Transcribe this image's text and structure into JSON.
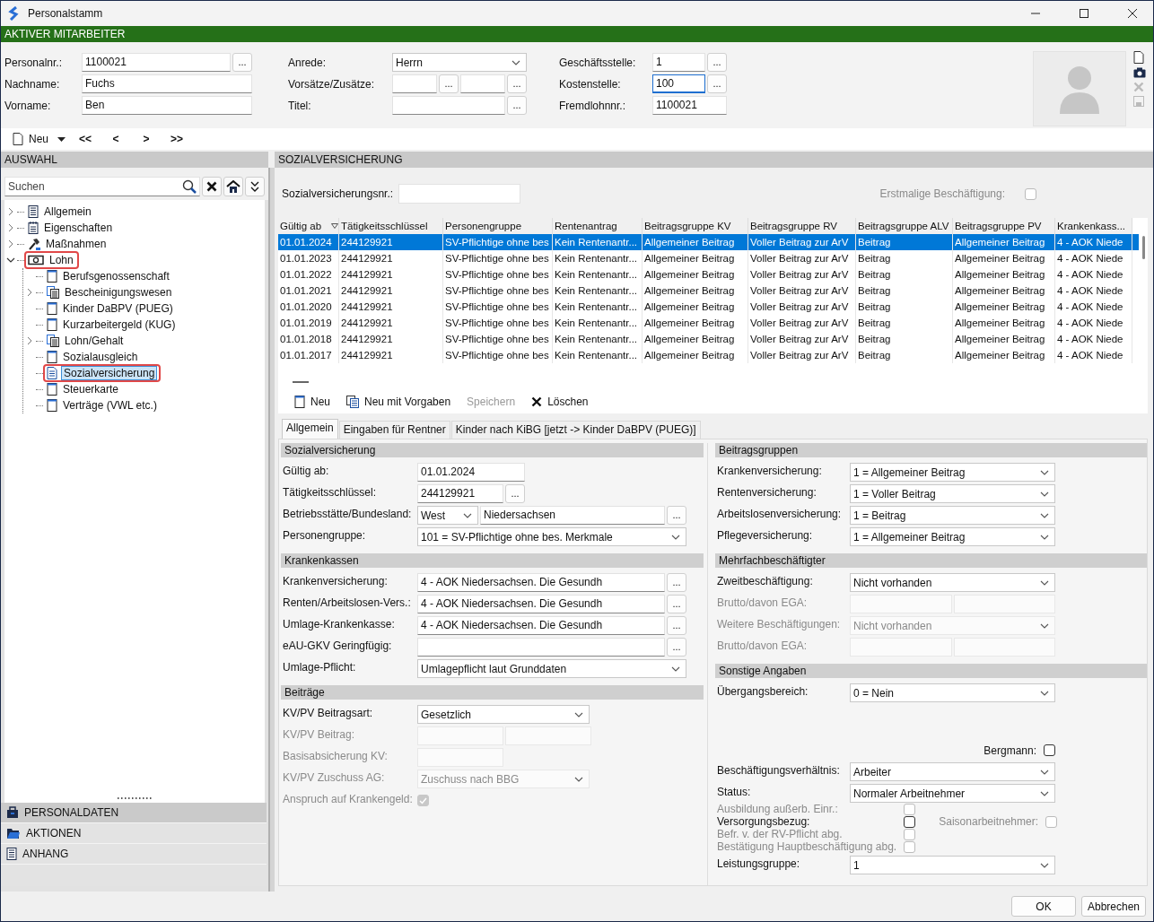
{
  "window": {
    "title": "Personalstamm"
  },
  "banner": "AKTIVER MITARBEITER",
  "header": {
    "columns": [
      [
        {
          "label": "Personalnr.:",
          "parts": [
            {
              "kind": "field",
              "value": "1100021",
              "focused": false
            },
            {
              "kind": "more",
              "text": "..."
            }
          ]
        },
        {
          "label": "Nachname:",
          "parts": [
            {
              "kind": "field",
              "value": "Fuchs",
              "focused": false
            }
          ]
        },
        {
          "label": "Vorname:",
          "parts": [
            {
              "kind": "field",
              "value": "Ben",
              "focused": false
            }
          ]
        }
      ],
      [
        {
          "label": "Anrede:",
          "parts": [
            {
              "kind": "select",
              "value": "Herrn"
            }
          ]
        },
        {
          "label": "Vorsätze/Zusätze:",
          "parts": [
            {
              "kind": "shortfield",
              "focused": false
            },
            {
              "kind": "more",
              "text": "..."
            },
            {
              "kind": "shortfield",
              "focused": false
            },
            {
              "kind": "more",
              "text": "..."
            }
          ]
        },
        {
          "label": "Titel:",
          "parts": [
            {
              "kind": "field",
              "focused": false
            },
            {
              "kind": "more",
              "text": "..."
            }
          ]
        }
      ],
      [
        {
          "label": "Geschäftsstelle:",
          "parts": [
            {
              "kind": "field",
              "value": "1",
              "focused": false
            },
            {
              "kind": "more",
              "text": "..."
            }
          ]
        },
        {
          "label": "Kostenstelle:",
          "parts": [
            {
              "kind": "field",
              "value": "100",
              "focused": true
            },
            {
              "kind": "more",
              "text": "..."
            }
          ]
        },
        {
          "label": "Fremdlohnnr.:",
          "parts": [
            {
              "kind": "field",
              "value": "1100021",
              "focused": false
            }
          ]
        }
      ]
    ]
  },
  "toolbar": {
    "new": "Neu",
    "nav": [
      "<<",
      "<",
      ">",
      ">>"
    ]
  },
  "selection": {
    "title": "AUSWAHL",
    "search": {
      "placeholder": "Suchen"
    },
    "tree": [
      {
        "label": "Allgemein",
        "kind": "list",
        "expandable": true,
        "expanded": false,
        "selected": false,
        "highlighted": false
      },
      {
        "label": "Eigenschaften",
        "kind": "notepad",
        "expandable": true,
        "expanded": false,
        "selected": false,
        "highlighted": false
      },
      {
        "label": "Maßnahmen",
        "kind": "hammer",
        "expandable": true,
        "expanded": false,
        "selected": false,
        "highlighted": false
      },
      {
        "label": "Lohn",
        "kind": "money",
        "expandable": true,
        "expanded": true,
        "selected": false,
        "highlighted": true,
        "children": [
          {
            "label": "Berufsgenossenschaft",
            "kind": "page",
            "expandable": false,
            "selected": false,
            "highlighted": false
          },
          {
            "label": "Bescheinigungswesen",
            "kind": "pages",
            "expandable": true,
            "expanded": false,
            "selected": false,
            "highlighted": false
          },
          {
            "label": "Kinder DaBPV (PUEG)",
            "kind": "page",
            "expandable": false,
            "selected": false,
            "highlighted": false
          },
          {
            "label": "Kurzarbeitergeld (KUG)",
            "kind": "page",
            "expandable": false,
            "selected": false,
            "highlighted": false
          },
          {
            "label": "Lohn/Gehalt",
            "kind": "pages",
            "expandable": true,
            "expanded": false,
            "selected": false,
            "highlighted": false
          },
          {
            "label": "Sozialausgleich",
            "kind": "page",
            "expandable": false,
            "selected": false,
            "highlighted": false
          },
          {
            "label": "Sozialversicherung",
            "kind": "document",
            "expandable": false,
            "selected": true,
            "highlighted": true
          },
          {
            "label": "Steuerkarte",
            "kind": "page",
            "expandable": false,
            "selected": false,
            "highlighted": false
          },
          {
            "label": "Verträge (VWL etc.)",
            "kind": "page",
            "expandable": false,
            "selected": false,
            "highlighted": false
          }
        ]
      }
    ],
    "panels": [
      {
        "label": "PERSONALDATEN",
        "kind": "case",
        "selected": true
      },
      {
        "label": "AKTIONEN",
        "kind": "folder",
        "selected": false
      },
      {
        "label": "ANHANG",
        "kind": "list",
        "selected": false
      }
    ]
  },
  "detail": {
    "title": "SOZIALVERSICHERUNG",
    "sv_number": {
      "label": "Sozialversicherungsnr.:"
    },
    "first_employment": {
      "label": "Erstmalige Beschäftigung:",
      "checked": false
    },
    "table": {
      "columns": [
        {
          "label": "Gültig ab",
          "sorted": true
        },
        {
          "label": "Tätigkeitsschlüssel",
          "sorted": false
        },
        {
          "label": "Personengruppe",
          "sorted": false
        },
        {
          "label": "Rentenantrag",
          "sorted": false
        },
        {
          "label": "Beitragsgruppe KV",
          "sorted": false
        },
        {
          "label": "Beitragsgruppe RV",
          "sorted": false
        },
        {
          "label": "Beitragsgruppe ALV",
          "sorted": false
        },
        {
          "label": "Beitragsgruppe PV",
          "sorted": false
        },
        {
          "label": "Krankenkass...",
          "sorted": false
        }
      ],
      "rows": [
        {
          "selected": true,
          "cells": [
            "01.01.2024",
            "244129921",
            "SV-Pflichtige ohne bes",
            "Kein Rentenantr...",
            "Allgemeiner Beitrag",
            "Voller Beitrag zur ArV",
            "Beitrag",
            "Allgemeiner Beitrag",
            "4 - AOK Niede"
          ]
        },
        {
          "selected": false,
          "cells": [
            "01.01.2023",
            "244129921",
            "SV-Pflichtige ohne bes",
            "Kein Rentenantr...",
            "Allgemeiner Beitrag",
            "Voller Beitrag zur ArV",
            "Beitrag",
            "Allgemeiner Beitrag",
            "4 - AOK Niede"
          ]
        },
        {
          "selected": false,
          "cells": [
            "01.01.2022",
            "244129921",
            "SV-Pflichtige ohne bes",
            "Kein Rentenantr...",
            "Allgemeiner Beitrag",
            "Voller Beitrag zur ArV",
            "Beitrag",
            "Allgemeiner Beitrag",
            "4 - AOK Niede"
          ]
        },
        {
          "selected": false,
          "cells": [
            "01.01.2021",
            "244129921",
            "SV-Pflichtige ohne bes",
            "Kein Rentenantr...",
            "Allgemeiner Beitrag",
            "Voller Beitrag zur ArV",
            "Beitrag",
            "Allgemeiner Beitrag",
            "4 - AOK Niede"
          ]
        },
        {
          "selected": false,
          "cells": [
            "01.01.2020",
            "244129921",
            "SV-Pflichtige ohne bes",
            "Kein Rentenantr...",
            "Allgemeiner Beitrag",
            "Voller Beitrag zur ArV",
            "Beitrag",
            "Allgemeiner Beitrag",
            "4 - AOK Niede"
          ]
        },
        {
          "selected": false,
          "cells": [
            "01.01.2019",
            "244129921",
            "SV-Pflichtige ohne bes",
            "Kein Rentenantr...",
            "Allgemeiner Beitrag",
            "Voller Beitrag zur ArV",
            "Beitrag",
            "Allgemeiner Beitrag",
            "4 - AOK Niede"
          ]
        },
        {
          "selected": false,
          "cells": [
            "01.01.2018",
            "244129921",
            "SV-Pflichtige ohne bes",
            "Kein Rentenantr...",
            "Allgemeiner Beitrag",
            "Voller Beitrag zur ArV",
            "Beitrag",
            "Allgemeiner Beitrag",
            "4 - AOK Niede"
          ]
        },
        {
          "selected": false,
          "cells": [
            "01.01.2017",
            "244129921",
            "SV-Pflichtige ohne bes",
            "Kein Rentenantr...",
            "Allgemeiner Beitrag",
            "Voller Beitrag zur ArV",
            "Beitrag",
            "Allgemeiner Beitrag",
            "4 - AOK Niede"
          ]
        }
      ]
    },
    "actions": [
      {
        "label": "Neu",
        "kind": "page",
        "disabled": false
      },
      {
        "label": "Neu mit Vorgaben",
        "kind": "copy",
        "disabled": false
      },
      {
        "label": "Speichern",
        "kind": "plain",
        "disabled": true
      },
      {
        "label": "Löschen",
        "kind": "cross",
        "disabled": false
      }
    ],
    "tabs": [
      {
        "label": "Allgemein",
        "selected": true
      },
      {
        "label": "Eingaben für Rentner",
        "selected": false
      },
      {
        "label": "Kinder nach KiBG [jetzt -> Kinder DaBPV (PUEG)]",
        "selected": false
      }
    ],
    "form": {
      "left": [
        {
          "title": "Sozialversicherung",
          "rows": [
            {
              "kind": "input",
              "label": "Gültig ab:",
              "disabled": false,
              "parts": [
                {
                  "kind": "datefield",
                  "value": "01.01.2024"
                }
              ]
            },
            {
              "kind": "input",
              "label": "Tätigkeitsschlüssel:",
              "disabled": false,
              "parts": [
                {
                  "kind": "shortfield",
                  "value": "244129921"
                },
                {
                  "kind": "more",
                  "text": "..."
                }
              ]
            },
            {
              "kind": "input",
              "label": "Betriebsstätte/Bundesland:",
              "disabled": false,
              "parts": [
                {
                  "kind": "tinyselect",
                  "value": "West"
                },
                {
                  "kind": "field",
                  "value": "Niedersachsen"
                },
                {
                  "kind": "more",
                  "text": "..."
                }
              ]
            },
            {
              "kind": "input",
              "label": "Personengruppe:",
              "disabled": false,
              "parts": [
                {
                  "kind": "select",
                  "value": "101 = SV-Pflichtige ohne bes. Merkmale"
                }
              ]
            }
          ]
        },
        {
          "title": "Krankenkassen",
          "rows": [
            {
              "kind": "input",
              "label": "Krankenversicherung:",
              "disabled": false,
              "parts": [
                {
                  "kind": "field",
                  "value": "4 - AOK Niedersachsen. Die Gesundh"
                },
                {
                  "kind": "more",
                  "text": "..."
                }
              ]
            },
            {
              "kind": "input",
              "label": "Renten/Arbeitslosen-Vers.:",
              "disabled": false,
              "parts": [
                {
                  "kind": "field",
                  "value": "4 - AOK Niedersachsen. Die Gesundh"
                },
                {
                  "kind": "more",
                  "text": "..."
                }
              ]
            },
            {
              "kind": "input",
              "label": "Umlage-Krankenkasse:",
              "disabled": false,
              "parts": [
                {
                  "kind": "field",
                  "value": "4 - AOK Niedersachsen. Die Gesundh"
                },
                {
                  "kind": "more",
                  "text": "..."
                }
              ]
            },
            {
              "kind": "input",
              "label": "eAU-GKV Geringfügig:",
              "disabled": false,
              "parts": [
                {
                  "kind": "field"
                },
                {
                  "kind": "more",
                  "text": "..."
                }
              ]
            },
            {
              "kind": "input",
              "label": "Umlage-Pflicht:",
              "disabled": false,
              "parts": [
                {
                  "kind": "select",
                  "value": "Umlagepflicht laut Grunddaten"
                }
              ]
            }
          ]
        },
        {
          "title": "Beiträge",
          "rows": [
            {
              "kind": "input",
              "label": "KV/PV Beitragsart:",
              "disabled": false,
              "parts": [
                {
                  "kind": "halfselect",
                  "value": "Gesetzlich"
                }
              ]
            },
            {
              "kind": "input",
              "label": "KV/PV Beitrag:",
              "disabled": true,
              "parts": [
                {
                  "kind": "shortfield"
                },
                {
                  "kind": "shortfield"
                }
              ]
            },
            {
              "kind": "input",
              "label": "Basisabsicherung KV:",
              "disabled": true,
              "parts": [
                {
                  "kind": "shortfield"
                }
              ]
            },
            {
              "kind": "input",
              "label": "KV/PV Zuschuss AG:",
              "disabled": true,
              "parts": [
                {
                  "kind": "halfselect",
                  "value": "Zuschuss nach BBG"
                }
              ]
            },
            {
              "kind": "input",
              "label": "Anspruch auf Krankengeld:",
              "disabled": true,
              "parts": [
                {
                  "kind": "checkbox",
                  "checked": true
                }
              ]
            }
          ]
        }
      ],
      "right": [
        {
          "title": "Beitragsgruppen",
          "rows": [
            {
              "kind": "input",
              "label": "Krankenversicherung:",
              "disabled": false,
              "parts": [
                {
                  "kind": "select",
                  "value": "1 = Allgemeiner Beitrag"
                }
              ]
            },
            {
              "kind": "input",
              "label": "Rentenversicherung:",
              "disabled": false,
              "parts": [
                {
                  "kind": "select",
                  "value": "1 = Voller Beitrag"
                }
              ]
            },
            {
              "kind": "input",
              "label": "Arbeitslosenversicherung:",
              "disabled": false,
              "parts": [
                {
                  "kind": "select",
                  "value": "1 = Beitrag"
                }
              ]
            },
            {
              "kind": "input",
              "label": "Pflegeversicherung:",
              "disabled": false,
              "parts": [
                {
                  "kind": "select",
                  "value": "1 = Allgemeiner Beitrag"
                }
              ]
            }
          ]
        },
        {
          "title": "Mehrfachbeschäftigter",
          "rows": [
            {
              "kind": "input",
              "label": "Zweitbeschäftigung:",
              "disabled": false,
              "parts": [
                {
                  "kind": "select",
                  "value": "Nicht vorhanden"
                }
              ]
            },
            {
              "kind": "input",
              "label": "Brutto/davon EGA:",
              "disabled": true,
              "parts": [
                {
                  "kind": "field"
                },
                {
                  "kind": "field"
                }
              ]
            },
            {
              "kind": "input",
              "label": "Weitere Beschäftigungen:",
              "disabled": true,
              "parts": [
                {
                  "kind": "select",
                  "value": "Nicht vorhanden"
                }
              ]
            },
            {
              "kind": "input",
              "label": "Brutto/davon EGA:",
              "disabled": true,
              "parts": [
                {
                  "kind": "field"
                },
                {
                  "kind": "field"
                }
              ]
            }
          ]
        },
        {
          "title": "Sonstige Angaben",
          "rows": [
            {
              "kind": "input",
              "label": "Übergangsbereich:",
              "disabled": false,
              "parts": [
                {
                  "kind": "select",
                  "value": "0 = Nein"
                }
              ]
            },
            {
              "kind": "flag",
              "label": "Bergmann:",
              "checked": false,
              "disabled": false
            },
            {
              "kind": "input",
              "label": "Beschäftigungsverhältnis:",
              "disabled": false,
              "parts": [
                {
                  "kind": "select",
                  "value": "Arbeiter"
                }
              ]
            },
            {
              "kind": "input",
              "label": "Status:",
              "disabled": false,
              "parts": [
                {
                  "kind": "select",
                  "value": "Normaler Arbeitnehmer"
                }
              ]
            },
            {
              "kind": "checks",
              "items": [
                {
                  "label": "Ausbildung außerb. Einr.:",
                  "checked": false,
                  "disabled": true
                }
              ]
            },
            {
              "kind": "checks",
              "items": [
                {
                  "label": "Versorgungsbezug:",
                  "checked": false,
                  "disabled": false
                },
                {
                  "label": "Saisonarbeitnehmer:",
                  "checked": false,
                  "disabled": true
                }
              ]
            },
            {
              "kind": "checks",
              "items": [
                {
                  "label": "Befr. v. der RV-Pflicht abg.",
                  "checked": false,
                  "disabled": true
                }
              ]
            },
            {
              "kind": "checks",
              "items": [
                {
                  "label": "Bestätigung Hauptbeschäftigung abg.",
                  "checked": false,
                  "disabled": true
                }
              ]
            },
            {
              "kind": "input",
              "label": "Leistungsgruppe:",
              "disabled": false,
              "parts": [
                {
                  "kind": "select",
                  "value": "1"
                }
              ]
            }
          ]
        }
      ]
    }
  },
  "buttons": [
    {
      "label": "OK"
    },
    {
      "label": "Abbrechen"
    }
  ]
}
